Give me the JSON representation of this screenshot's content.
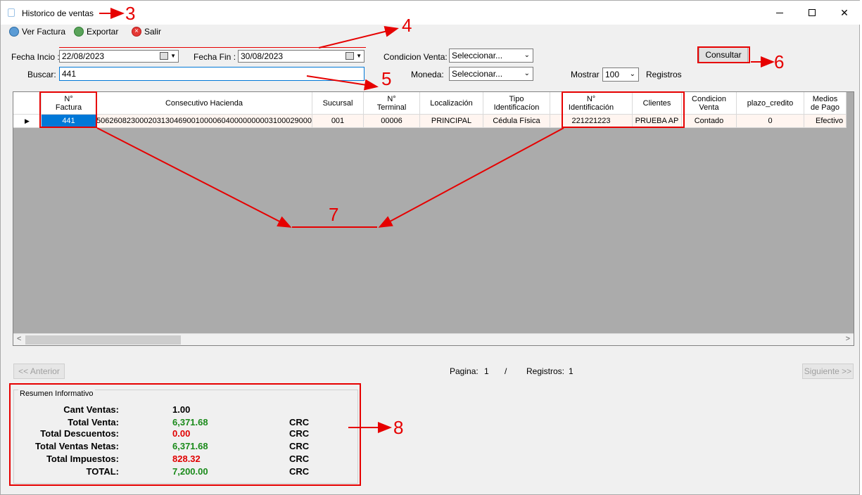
{
  "window": {
    "title": "Historico de ventas"
  },
  "toolbar": {
    "view_invoice": "Ver Factura",
    "export": "Exportar",
    "exit": "Salir"
  },
  "filters": {
    "fecha_inicio_label": "Fecha Incio :",
    "fecha_inicio_value": "22/08/2023",
    "fecha_fin_label": "Fecha Fin :",
    "fecha_fin_value": "30/08/2023",
    "condicion_label": "Condicion Venta:",
    "condicion_value": "Seleccionar...",
    "buscar_label": "Buscar:",
    "buscar_value": "441",
    "moneda_label": "Moneda:",
    "moneda_value": "Seleccionar...",
    "mostrar_label": "Mostrar",
    "mostrar_value": "100",
    "registros_label": "Registros",
    "consultar_label": "Consultar"
  },
  "grid": {
    "columns": [
      "N°\nFactura",
      "Consecutivo Hacienda",
      "Sucursal",
      "N°\nTerminal",
      "Localización",
      "Tipo\nIdentificacíon",
      "N°\nIdentificación",
      "Clientes",
      "Condicion\nVenta",
      "plazo_credito",
      "Medios\nde Pago"
    ],
    "rows": [
      [
        "441",
        "50626082300020313046900100006040000000003100029000",
        "001",
        "00006",
        "PRINCIPAL",
        "Cédula Física",
        "221221223",
        "PRUEBA AP",
        "Contado",
        "0",
        "Efectivo"
      ]
    ]
  },
  "pager": {
    "prev": "<< Anterior",
    "next": "Siguiente >>",
    "pagina_label": "Pagina:",
    "pagina_value": "1",
    "sep": "/",
    "registros_label": "Registros:",
    "registros_value": "1"
  },
  "summary": {
    "title": "Resumen Informativo",
    "items": [
      {
        "label": "Cant Ventas:",
        "value": "1.00",
        "currency": ""
      },
      {
        "label": "Total Venta:",
        "value": "6,371.68",
        "currency": "CRC"
      },
      {
        "label": "Total Descuentos:",
        "value": "0.00",
        "currency": "CRC"
      },
      {
        "label": "Total Ventas Netas:",
        "value": "6,371.68",
        "currency": "CRC"
      },
      {
        "label": "Total Impuestos:",
        "value": "828.32",
        "currency": "CRC"
      },
      {
        "label": "TOTAL:",
        "value": "7,200.00",
        "currency": "CRC"
      }
    ]
  },
  "annotations": {
    "a3": "3",
    "a4": "4",
    "a5": "5",
    "a6": "6",
    "a7": "7",
    "a8": "8"
  },
  "colors": {
    "accent": "#0078d7",
    "annotation": "#e60000",
    "positive": "#1a8a1a",
    "negative": "#e00000"
  }
}
